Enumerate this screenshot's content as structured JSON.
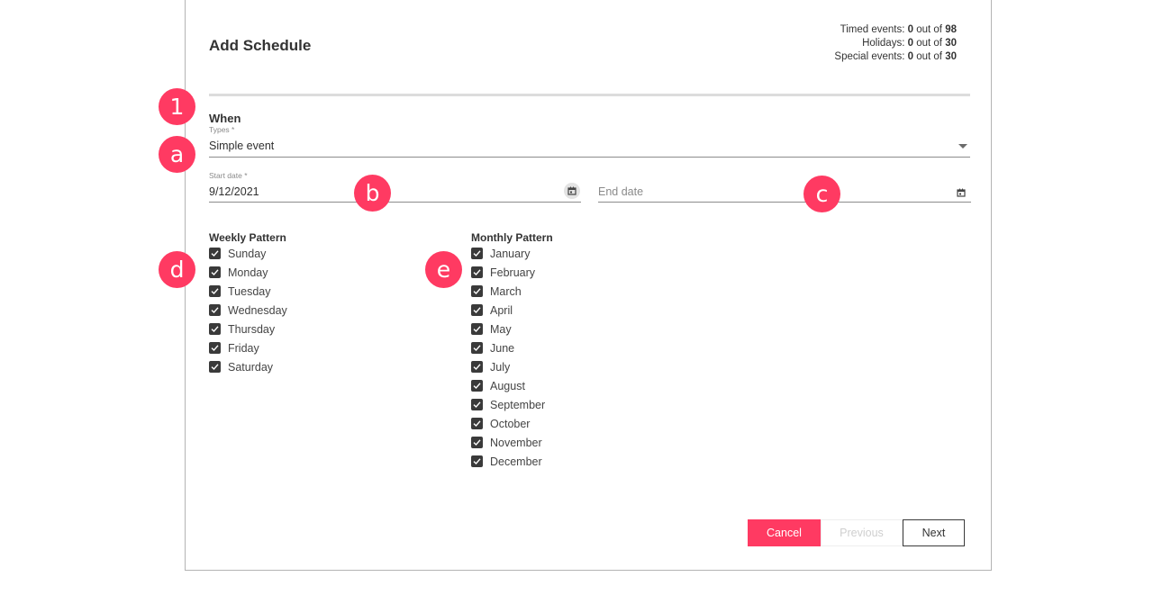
{
  "dialog": {
    "title": "Add Schedule",
    "quota": {
      "timed": {
        "label": "Timed events:",
        "used": "0",
        "sep": "out of",
        "max": "98"
      },
      "holidays": {
        "label": "Holidays:",
        "used": "0",
        "sep": "out of",
        "max": "30"
      },
      "special": {
        "label": "Special events:",
        "used": "0",
        "sep": "out of",
        "max": "30"
      }
    }
  },
  "when": {
    "heading": "When",
    "types": {
      "label": "Types *",
      "value": "Simple event"
    },
    "start_date": {
      "label": "Start date *",
      "value": "9/12/2021"
    },
    "end_date": {
      "placeholder": "End date"
    }
  },
  "weekly": {
    "title": "Weekly Pattern",
    "items": [
      "Sunday",
      "Monday",
      "Tuesday",
      "Wednesday",
      "Thursday",
      "Friday",
      "Saturday"
    ]
  },
  "monthly": {
    "title": "Monthly Pattern",
    "items": [
      "January",
      "February",
      "March",
      "April",
      "May",
      "June",
      "July",
      "August",
      "September",
      "October",
      "November",
      "December"
    ]
  },
  "buttons": {
    "cancel": "Cancel",
    "previous": "Previous",
    "next": "Next"
  },
  "markers": {
    "m1": "1",
    "a": "a",
    "b": "b",
    "c": "c",
    "d": "d",
    "e": "e"
  },
  "colors": {
    "accent": "#ff3a62",
    "checkbox": "#3a3a3a",
    "divider": "#dcdcdc"
  }
}
